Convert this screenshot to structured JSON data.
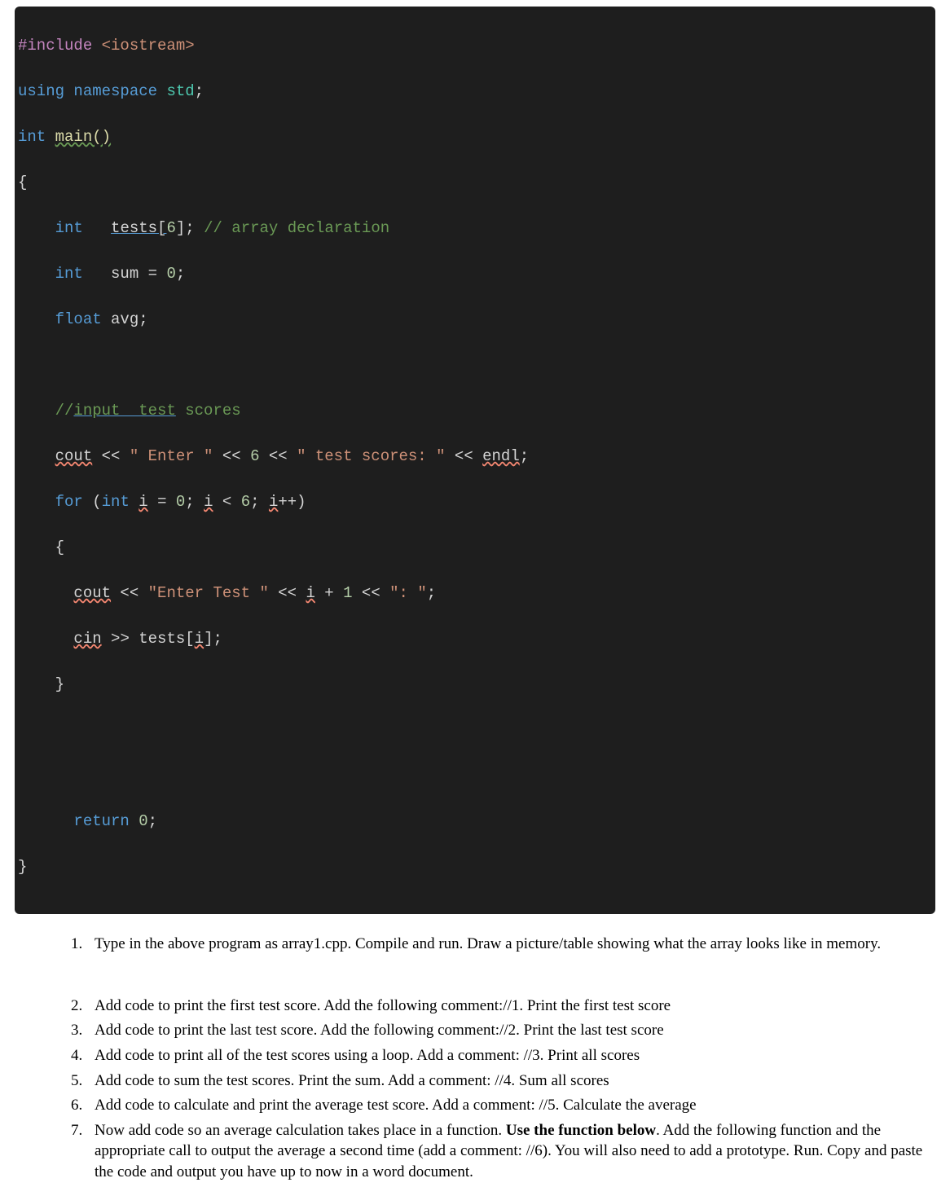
{
  "code": {
    "l1a": "#include",
    "l1b": " <iostream>",
    "l2a": "using",
    "l2b": " namespace",
    "l2c": " std",
    "l2d": ";",
    "l3a": "int",
    "l3b": " ",
    "l3c": "main()",
    "l4": "{",
    "l5a": "    ",
    "l5b": "int",
    "l5c": "   ",
    "l5d": "tests[",
    "l5e": "6",
    "l5f": "];",
    "l5g": " // array declaration",
    "l6a": "    ",
    "l6b": "int",
    "l6c": "   sum = ",
    "l6d": "0",
    "l6e": ";",
    "l7a": "    ",
    "l7b": "float",
    "l7c": " avg;",
    "l8": " ",
    "l9a": "    ",
    "l9b": "//",
    "l9c": "input  test",
    "l9d": " scores",
    "l10a": "    ",
    "l10b": "cout",
    "l10c": " << ",
    "l10d": "\" Enter \"",
    "l10e": " << ",
    "l10f": "6",
    "l10g": " << ",
    "l10h": "\" test scores: \"",
    "l10i": " << ",
    "l10j": "endl",
    "l10k": ";",
    "l11a": "    ",
    "l11b": "for",
    "l11c": " (",
    "l11d": "int",
    "l11e": " ",
    "l11f": "i",
    "l11g": " = ",
    "l11h": "0",
    "l11i": "; ",
    "l11j": "i",
    "l11k": " < ",
    "l11l": "6",
    "l11m": "; ",
    "l11n": "i",
    "l11o": "++)",
    "l12": "    {",
    "l13a": "      ",
    "l13b": "cout",
    "l13c": " << ",
    "l13d": "\"Enter Test \"",
    "l13e": " << ",
    "l13f": "i",
    "l13g": " + ",
    "l13h": "1",
    "l13i": " << ",
    "l13j": "\": \"",
    "l13k": ";",
    "l14a": "      ",
    "l14b": "cin",
    "l14c": " >> tests[",
    "l14d": "i",
    "l14e": "];",
    "l15": "    }",
    "l16": " ",
    "l17": " ",
    "l18a": "      ",
    "l18b": "return",
    "l18c": " ",
    "l18d": "0",
    "l18e": ";",
    "l19": "}"
  },
  "instructions": {
    "i1": "Type in the above program as array1.cpp. Compile and run. Draw a picture/table showing what the array looks like in memory.",
    "i2": "Add code to print the first test score. Add the following comment://1. Print the first test score",
    "i3": "Add code to print the last test score. Add the following comment://2. Print the last test score",
    "i4": "Add code to print all of the test scores using a loop. Add a comment: //3. Print all scores",
    "i5": "Add code to sum the test scores. Print the sum. Add a comment: //4. Sum all scores",
    "i6": "Add code to calculate and print the average test score.  Add a comment: //5. Calculate the average",
    "i7a": "Now add code so an average calculation takes place in a function. ",
    "i7b": "Use the function below",
    "i7c": ". Add the following function and the appropriate call to output the average a second time (add a comment: //6). You will also need to add a prototype. Run. Copy and paste the code and output you have up to now in a word document."
  }
}
